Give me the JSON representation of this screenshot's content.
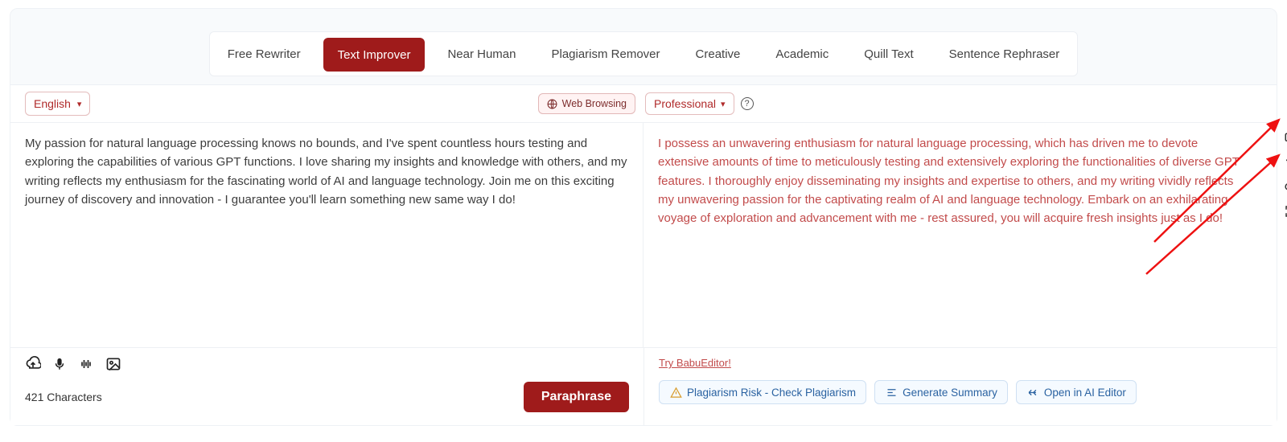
{
  "tabs": [
    {
      "label": "Free Rewriter",
      "active": false
    },
    {
      "label": "Text Improver",
      "active": true
    },
    {
      "label": "Near Human",
      "active": false
    },
    {
      "label": "Plagiarism Remover",
      "active": false
    },
    {
      "label": "Creative",
      "active": false
    },
    {
      "label": "Academic",
      "active": false
    },
    {
      "label": "Quill Text",
      "active": false
    },
    {
      "label": "Sentence Rephraser",
      "active": false
    }
  ],
  "language_select": "English",
  "web_browsing_label": "Web Browsing",
  "tone_select": "Professional",
  "input_text": "My passion for natural language processing knows no bounds, and I've spent countless hours testing and exploring the capabilities of various GPT functions. I love sharing my insights and knowledge with others, and my writing reflects my enthusiasm for the fascinating world of AI and language technology. Join me on this exciting journey of discovery and innovation - I guarantee you'll learn something new same way I do!",
  "output_text": "I possess an unwavering enthusiasm for natural language processing, which has driven me to devote extensive amounts of time to meticulously testing and extensively exploring the functionalities of diverse GPT features. I thoroughly enjoy disseminating my insights and expertise to others, and my writing vividly reflects my unwavering passion for the captivating realm of AI and language technology. Embark on an exhilarating voyage of exploration and advancement with me - rest assured, you will acquire fresh insights just as I do!",
  "char_count_label": "421 Characters",
  "paraphrase_label": "Paraphrase",
  "try_link": "Try BabuEditor!",
  "chips": {
    "plagiarism": "Plagiarism Risk - Check Plagiarism",
    "summary": "Generate Summary",
    "editor": "Open in AI Editor"
  }
}
